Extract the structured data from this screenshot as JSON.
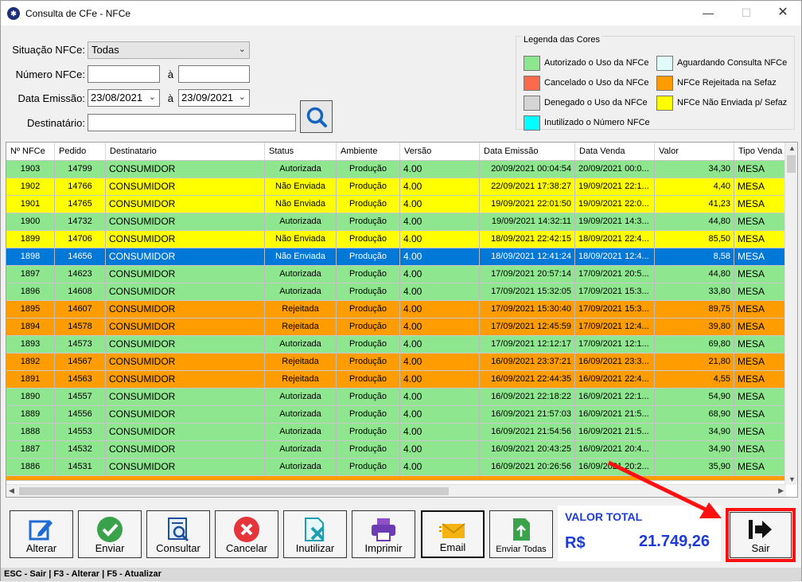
{
  "window": {
    "title": "Consulta de CFe - NFCe",
    "icon": "app-logo-icon"
  },
  "filters": {
    "situacao_label": "Situação NFCe:",
    "situacao_value": "Todas",
    "numero_label": "Número NFCe:",
    "numero_from": "",
    "numero_to": "",
    "a_sep": "à",
    "data_label": "Data Emissão:",
    "data_from": "23/08/2021",
    "data_to": "23/09/2021",
    "destinatario_label": "Destinatário:",
    "destinatario_value": ""
  },
  "legend": {
    "title": "Legenda das Cores",
    "items": [
      {
        "label": "Autorizado o Uso da NFCe",
        "color": "#8ee68e"
      },
      {
        "label": "Aguardando Consulta NFCe",
        "color": "#e1fbfb"
      },
      {
        "label": "Cancelado o Uso da NFCe",
        "color": "#fb6a4a"
      },
      {
        "label": "NFCe Rejeitada na Sefaz",
        "color": "#ff9d00"
      },
      {
        "label": "Denegado o Uso da NFCe",
        "color": "#d4d4d4"
      },
      {
        "label": "NFCe Não Enviada p/ Sefaz",
        "color": "#ffff00"
      },
      {
        "label": "Inutilizado o Número NFCe",
        "color": "#00ffff"
      }
    ]
  },
  "grid": {
    "columns": [
      "Nº NFCe",
      "Pedido",
      "Destinatario",
      "Status",
      "Ambiente",
      "Versão",
      "Data Emissão",
      "Data Venda",
      "Valor",
      "Tipo Venda"
    ],
    "rows": [
      {
        "nfce": "1903",
        "pedido": "14799",
        "dest": "CONSUMIDOR",
        "status": "Autorizada",
        "amb": "Produção",
        "ver": "4.00",
        "emissao": "20/09/2021 00:04:54",
        "venda": "20/09/2021 00:0...",
        "valor": "34,30",
        "tipo": "MESA",
        "color": "#8ee68e"
      },
      {
        "nfce": "1902",
        "pedido": "14766",
        "dest": "CONSUMIDOR",
        "status": "Não Enviada",
        "amb": "Produção",
        "ver": "4.00",
        "emissao": "22/09/2021 17:38:27",
        "venda": "19/09/2021 22:1...",
        "valor": "4,40",
        "tipo": "MESA",
        "color": "#ffff00"
      },
      {
        "nfce": "1901",
        "pedido": "14765",
        "dest": "CONSUMIDOR",
        "status": "Não Enviada",
        "amb": "Produção",
        "ver": "4.00",
        "emissao": "19/09/2021 22:01:50",
        "venda": "19/09/2021 22:0...",
        "valor": "41,23",
        "tipo": "MESA",
        "color": "#ffff00"
      },
      {
        "nfce": "1900",
        "pedido": "14732",
        "dest": "CONSUMIDOR",
        "status": "Autorizada",
        "amb": "Produção",
        "ver": "4.00",
        "emissao": "19/09/2021 14:32:11",
        "venda": "19/09/2021 14:3...",
        "valor": "44,80",
        "tipo": "MESA",
        "color": "#8ee68e"
      },
      {
        "nfce": "1899",
        "pedido": "14706",
        "dest": "CONSUMIDOR",
        "status": "Não Enviada",
        "amb": "Produção",
        "ver": "4.00",
        "emissao": "18/09/2021 22:42:15",
        "venda": "18/09/2021 22:4...",
        "valor": "85,50",
        "tipo": "MESA",
        "color": "#ffff00"
      },
      {
        "nfce": "1898",
        "pedido": "14656",
        "dest": "CONSUMIDOR",
        "status": "Não Enviada",
        "amb": "Produção",
        "ver": "4.00",
        "emissao": "18/09/2021 12:41:24",
        "venda": "18/09/2021 12:4...",
        "valor": "8,58",
        "tipo": "MESA",
        "color": "#0078d7",
        "selected": true
      },
      {
        "nfce": "1897",
        "pedido": "14623",
        "dest": "CONSUMIDOR",
        "status": "Autorizada",
        "amb": "Produção",
        "ver": "4.00",
        "emissao": "17/09/2021 20:57:14",
        "venda": "17/09/2021 20:5...",
        "valor": "44,80",
        "tipo": "MESA",
        "color": "#8ee68e"
      },
      {
        "nfce": "1896",
        "pedido": "14608",
        "dest": "CONSUMIDOR",
        "status": "Autorizada",
        "amb": "Produção",
        "ver": "4.00",
        "emissao": "17/09/2021 15:32:05",
        "venda": "17/09/2021 15:3...",
        "valor": "33,80",
        "tipo": "MESA",
        "color": "#8ee68e"
      },
      {
        "nfce": "1895",
        "pedido": "14607",
        "dest": "CONSUMIDOR",
        "status": "Rejeitada",
        "amb": "Produção",
        "ver": "4.00",
        "emissao": "17/09/2021 15:30:40",
        "venda": "17/09/2021 15:3...",
        "valor": "89,75",
        "tipo": "MESA",
        "color": "#ff9d00"
      },
      {
        "nfce": "1894",
        "pedido": "14578",
        "dest": "CONSUMIDOR",
        "status": "Rejeitada",
        "amb": "Produção",
        "ver": "4.00",
        "emissao": "17/09/2021 12:45:59",
        "venda": "17/09/2021 12:4...",
        "valor": "39,80",
        "tipo": "MESA",
        "color": "#ff9d00"
      },
      {
        "nfce": "1893",
        "pedido": "14573",
        "dest": "CONSUMIDOR",
        "status": "Autorizada",
        "amb": "Produção",
        "ver": "4.00",
        "emissao": "17/09/2021 12:12:17",
        "venda": "17/09/2021 12:1...",
        "valor": "69,80",
        "tipo": "MESA",
        "color": "#8ee68e"
      },
      {
        "nfce": "1892",
        "pedido": "14567",
        "dest": "CONSUMIDOR",
        "status": "Rejeitada",
        "amb": "Produção",
        "ver": "4.00",
        "emissao": "16/09/2021 23:37:21",
        "venda": "16/09/2021 23:3...",
        "valor": "21,80",
        "tipo": "MESA",
        "color": "#ff9d00"
      },
      {
        "nfce": "1891",
        "pedido": "14563",
        "dest": "CONSUMIDOR",
        "status": "Rejeitada",
        "amb": "Produção",
        "ver": "4.00",
        "emissao": "16/09/2021 22:44:35",
        "venda": "16/09/2021 22:4...",
        "valor": "4,55",
        "tipo": "MESA",
        "color": "#ff9d00"
      },
      {
        "nfce": "1890",
        "pedido": "14557",
        "dest": "CONSUMIDOR",
        "status": "Autorizada",
        "amb": "Produção",
        "ver": "4.00",
        "emissao": "16/09/2021 22:18:22",
        "venda": "16/09/2021 22:1...",
        "valor": "54,90",
        "tipo": "MESA",
        "color": "#8ee68e"
      },
      {
        "nfce": "1889",
        "pedido": "14556",
        "dest": "CONSUMIDOR",
        "status": "Autorizada",
        "amb": "Produção",
        "ver": "4.00",
        "emissao": "16/09/2021 21:57:03",
        "venda": "16/09/2021 21:5...",
        "valor": "68,90",
        "tipo": "MESA",
        "color": "#8ee68e"
      },
      {
        "nfce": "1888",
        "pedido": "14553",
        "dest": "CONSUMIDOR",
        "status": "Autorizada",
        "amb": "Produção",
        "ver": "4.00",
        "emissao": "16/09/2021 21:54:56",
        "venda": "16/09/2021 21:5...",
        "valor": "34,90",
        "tipo": "MESA",
        "color": "#8ee68e"
      },
      {
        "nfce": "1887",
        "pedido": "14532",
        "dest": "CONSUMIDOR",
        "status": "Autorizada",
        "amb": "Produção",
        "ver": "4.00",
        "emissao": "16/09/2021 20:43:25",
        "venda": "16/09/2021 20:4...",
        "valor": "34,90",
        "tipo": "MESA",
        "color": "#8ee68e"
      },
      {
        "nfce": "1886",
        "pedido": "14531",
        "dest": "CONSUMIDOR",
        "status": "Autorizada",
        "amb": "Produção",
        "ver": "4.00",
        "emissao": "16/09/2021 20:26:56",
        "venda": "16/09/2021 20:2...",
        "valor": "35,90",
        "tipo": "MESA",
        "color": "#8ee68e"
      }
    ]
  },
  "buttons": [
    {
      "label": "Alterar",
      "icon": "edit-icon"
    },
    {
      "label": "Enviar",
      "icon": "check-icon"
    },
    {
      "label": "Consultar",
      "icon": "search-document-icon"
    },
    {
      "label": "Cancelar",
      "icon": "cancel-icon"
    },
    {
      "label": "Inutilizar",
      "icon": "delete-file-icon"
    },
    {
      "label": "Imprimir",
      "icon": "printer-icon"
    },
    {
      "label": "Email",
      "icon": "email-icon"
    },
    {
      "label": "Enviar Todas",
      "icon": "upload-file-icon"
    }
  ],
  "total": {
    "title": "VALOR TOTAL",
    "currency": "R$",
    "value": "21.749,26"
  },
  "sair": {
    "label": "Sair",
    "icon": "exit-arrow-icon"
  },
  "statusbar": "ESC - Sair | F3 - Alterar  |  F5 - Atualizar"
}
